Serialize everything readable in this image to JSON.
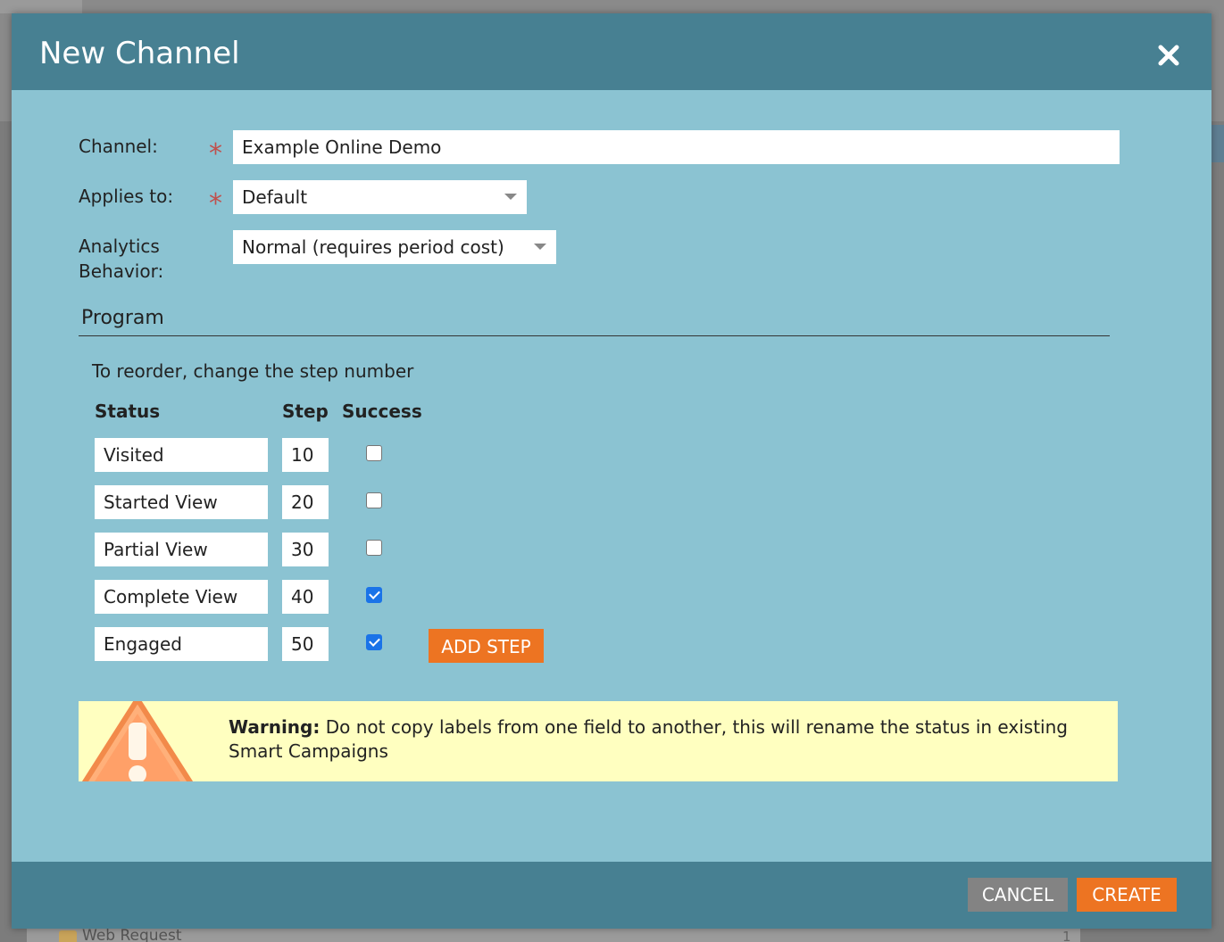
{
  "background": {
    "row_text": "Web Request",
    "row_count": "1"
  },
  "dialog": {
    "title": "New Channel",
    "close_icon": "close-icon",
    "form": {
      "channel_label": "Channel:",
      "channel_value": "Example Online Demo",
      "applies_to_label": "Applies to:",
      "applies_to_value": "Default",
      "analytics_label_line1": "Analytics",
      "analytics_label_line2": "Behavior:",
      "analytics_value": "Normal (requires period cost)",
      "required_marker": "*"
    },
    "program": {
      "heading": "Program",
      "hint": "To reorder, change the step number",
      "columns": {
        "status": "Status",
        "step": "Step",
        "success": "Success"
      },
      "rows": [
        {
          "status": "Visited",
          "step": "10",
          "success": false
        },
        {
          "status": "Started View",
          "step": "20",
          "success": false
        },
        {
          "status": "Partial View",
          "step": "30",
          "success": false
        },
        {
          "status": "Complete View",
          "step": "40",
          "success": true
        },
        {
          "status": "Engaged",
          "step": "50",
          "success": true
        }
      ],
      "add_step_label": "ADD STEP"
    },
    "warning": {
      "icon": "warning-triangle-icon",
      "bold": "Warning:",
      "text": "Do not copy labels from one field to another, this will rename the status in existing Smart Campaigns"
    },
    "footer": {
      "cancel_label": "CANCEL",
      "create_label": "CREATE"
    }
  },
  "colors": {
    "header": "#478092",
    "body": "#8bc3d2",
    "accent_orange": "#ed7422",
    "cancel_grey": "#838383",
    "warning_bg": "#ffffc0",
    "required": "#c0504d"
  }
}
